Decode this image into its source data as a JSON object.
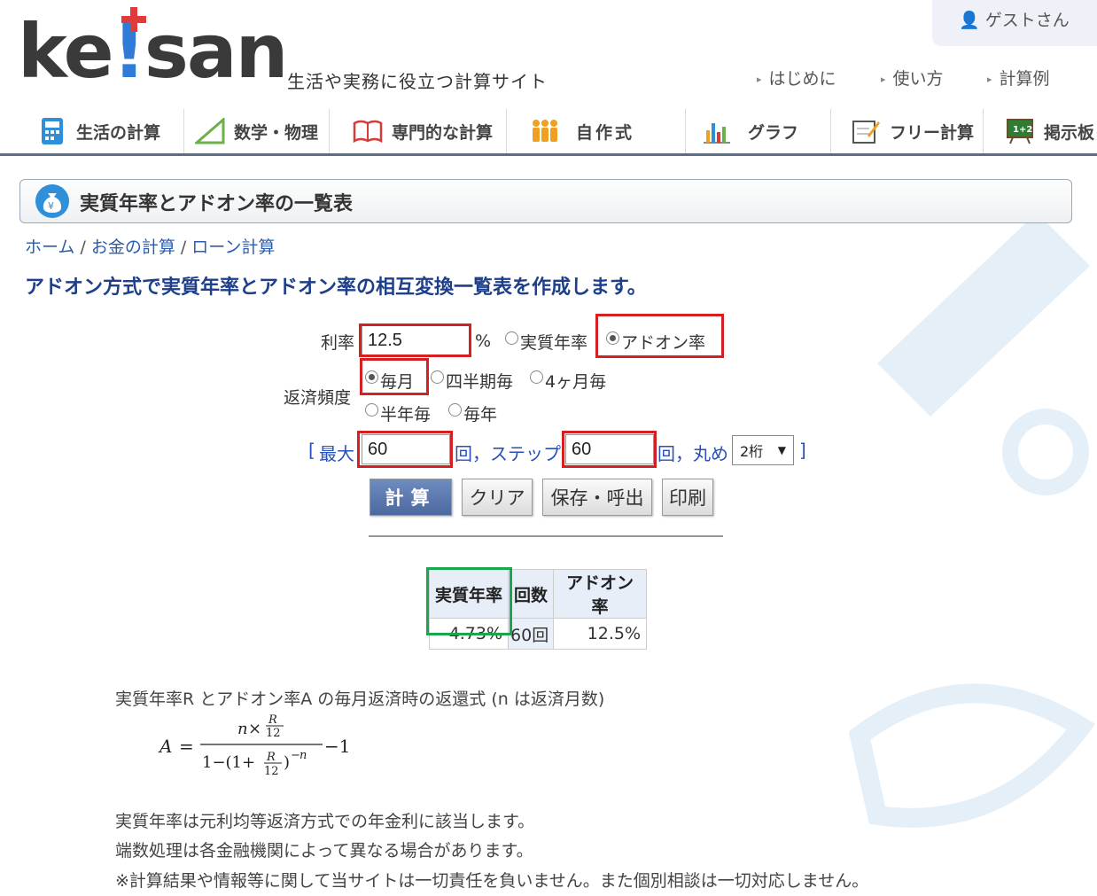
{
  "header": {
    "user": "ゲストさん",
    "logo_text": "keisan",
    "tagline": "生活や実務に役立つ計算サイト",
    "toplinks": [
      "はじめに",
      "使い方",
      "計算例"
    ]
  },
  "nav": [
    {
      "label": "生活の計算",
      "icon": "calculator-icon"
    },
    {
      "label": "数学・物理",
      "icon": "triangle-ruler-icon"
    },
    {
      "label": "専門的な計算",
      "icon": "book-icon"
    },
    {
      "label": "自作式",
      "icon": "people-icon"
    },
    {
      "label": "グラフ",
      "icon": "bar-chart-icon"
    },
    {
      "label": "フリー計算",
      "icon": "notepad-icon"
    },
    {
      "label": "掲示板",
      "icon": "board-icon"
    }
  ],
  "page": {
    "title": "実質年率とアドオン率の一覧表",
    "breadcrumb": [
      "ホーム",
      "お金の計算",
      "ローン計算"
    ],
    "lead": "アドオン方式で実質年率とアドオン率の相互変換一覧表を作成します。"
  },
  "form": {
    "rate_label": "利率",
    "rate_value": "12.5",
    "rate_unit": "%",
    "rate_type_options": [
      "実質年率",
      "アドオン率"
    ],
    "rate_type_selected": "アドオン率",
    "freq_label": "返済頻度",
    "freq_options": [
      "毎月",
      "四半期毎",
      "4ヶ月毎",
      "半年毎",
      "毎年"
    ],
    "freq_selected": "毎月",
    "open_bracket": "[",
    "max_label": "最大",
    "max_value": "60",
    "times_step": "回，ステップ",
    "step_value": "60",
    "times_round": "回，丸め",
    "round_value": "2桁",
    "close_bracket": "]",
    "buttons": {
      "calc": "計算",
      "clear": "クリア",
      "save": "保存・呼出",
      "print": "印刷"
    }
  },
  "result": {
    "headers": [
      "実質年率",
      "回数",
      "アドオン率"
    ],
    "rows": [
      [
        "4.73%",
        "60回",
        "12.5%"
      ]
    ]
  },
  "notes": {
    "formula_caption": "実質年率R とアドオン率A の毎月返済時の返還式 (n は返済月数)",
    "lines": [
      "実質年率は元利均等返済方式での年金利に該当します。",
      "端数処理は各金融機関によって異なる場合があります。",
      "※計算結果や情報等に関して当サイトは一切責任を負いません。また個別相談は一切対応しません。"
    ]
  }
}
